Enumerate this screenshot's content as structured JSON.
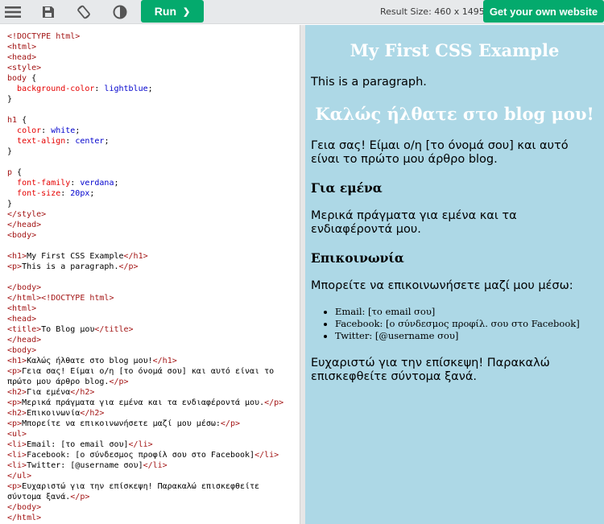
{
  "toolbar": {
    "menu_icon": "hamburger-menu-icon",
    "save_icon": "floppy-disk-icon",
    "rotate_icon": "rotate-orientation-icon",
    "contrast_icon": "contrast-icon",
    "run_label": "Run",
    "run_chevron": "❯",
    "result_size_label": "Result Size: 460 x 1495",
    "own_site_label": "Get your own website"
  },
  "colors": {
    "brand_green": "#04aa6d",
    "result_bg": "#add8e6"
  },
  "editor": {
    "lines": [
      "<!DOCTYPE html>",
      "<html>",
      "<head>",
      "<style>",
      "body {",
      "  background-color: lightblue;",
      "}",
      "",
      "h1 {",
      "  color: white;",
      "  text-align: center;",
      "}",
      "",
      "p {",
      "  font-family: verdana;",
      "  font-size: 20px;",
      "}",
      "</style>",
      "</head>",
      "<body>",
      "",
      "<h1>My First CSS Example</h1>",
      "<p>This is a paragraph.</p>",
      "",
      "</body>",
      "</html><!DOCTYPE html>",
      "<html>",
      "<head>",
      "<title>Το Blog μου</title>",
      "</head>",
      "<body>",
      "<h1>Καλώς ήλθατε στο blog μου!</h1>",
      "<p>Γεια σας! Είμαι ο/η [το όνομά σου] και αυτό είναι το",
      "πρώτο μου άρθρο blog.</p>",
      "<h2>Για εμένα</h2>",
      "<p>Μερικά πράγματα για εμένα και τα ενδιαφέροντά μου.</p>",
      "<h2>Επικοινωνία</h2>",
      "<p>Μπορείτε να επικοινωνήσετε μαζί μου μέσω:</p>",
      "<ul>",
      "<li>Email: [το email σου]</li>",
      "<li>Facebook: [ο σύνδεσμος προφίλ σου στο Facebook]</li>",
      "<li>Twitter: [@username σου]</li>",
      "</ul>",
      "<p>Ευχαριστώ για την επίσκεψη! Παρακαλώ επισκεφθείτε",
      "σύντομα ξανά.</p>",
      "</body>",
      "</html>"
    ]
  },
  "result": {
    "h1_first": "My First CSS Example",
    "p_first": "This is a paragraph.",
    "h1_second": "Καλώς ήλθατε στο blog μου!",
    "p_intro": "Γεια σας! Είμαι ο/η [το όνομά σου] και αυτό είναι το πρώτο μου άρθρο blog.",
    "h2_about": "Για εμένα",
    "p_about": "Μερικά πράγματα για εμένα και τα ενδιαφέροντά μου.",
    "h2_contact": "Επικοινωνία",
    "p_contact": "Μπορείτε να επικοινωνήσετε μαζί μου μέσω:",
    "list": [
      "Email: [το email σου]",
      "Facebook: [ο σύνδεσμος προφίλ. σου στο Facebook]",
      "Twitter: [@username σου]"
    ],
    "p_thanks": "Ευχαριστώ για την επίσκεψη! Παρακαλώ επισκεφθείτε σύντομα ξανά."
  }
}
